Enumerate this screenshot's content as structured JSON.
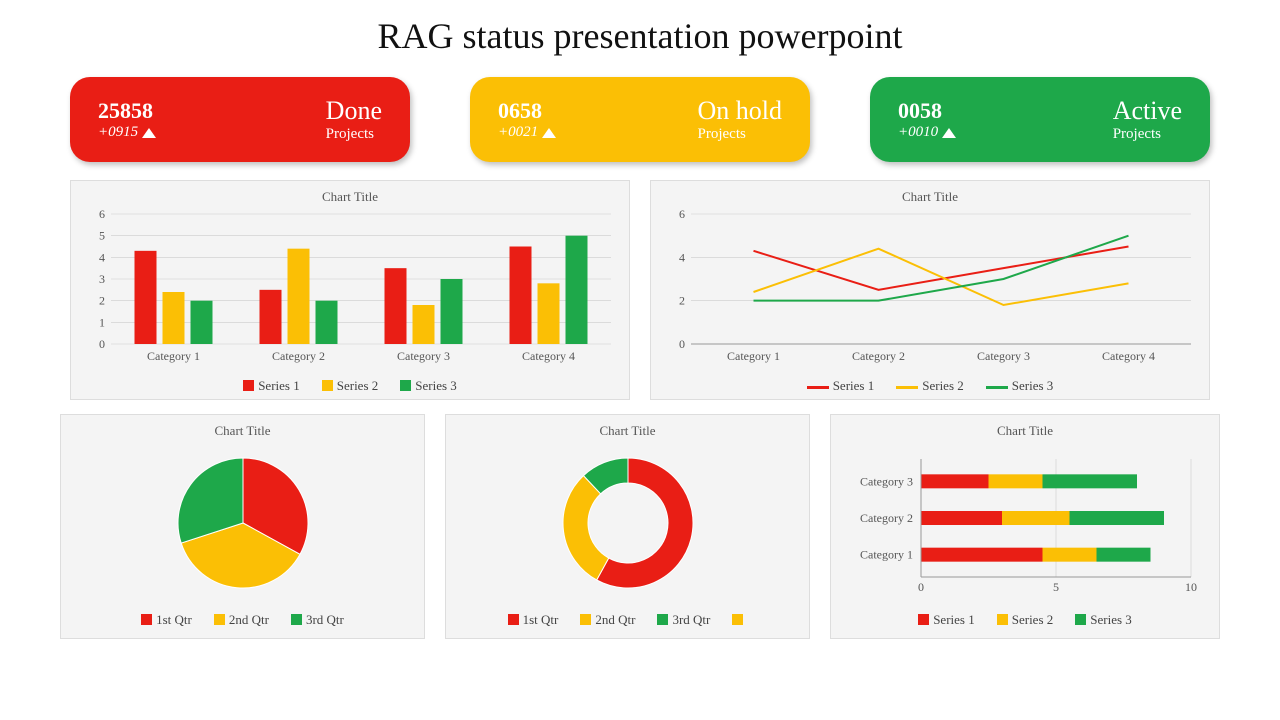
{
  "title": "RAG status presentation powerpoint",
  "cards": [
    {
      "value": "25858",
      "delta": "+0915",
      "status": "Done",
      "sub": "Projects"
    },
    {
      "value": "0658",
      "delta": "+0021",
      "status": "On hold",
      "sub": "Projects"
    },
    {
      "value": "0058",
      "delta": "+0010",
      "status": "Active",
      "sub": "Projects"
    }
  ],
  "chartTitleCommon": "Chart Title",
  "barLegend": [
    "Series 1",
    "Series 2",
    "Series 3"
  ],
  "lineLegend": [
    "Series 1",
    "Series 2",
    "Series 3"
  ],
  "pieLegend": [
    "1st Qtr",
    "2nd Qtr",
    "3rd Qtr"
  ],
  "donutLegend": [
    "1st Qtr",
    "2nd Qtr",
    "3rd Qtr",
    ""
  ],
  "hbarLegend": [
    "Series 1",
    "Series 2",
    "Series 3"
  ],
  "hbarCats": [
    "Category 3",
    "Category 2",
    "Category 1"
  ],
  "barCats": [
    "Category 1",
    "Category 2",
    "Category 3",
    "Category 4"
  ],
  "chart_data": [
    {
      "type": "bar",
      "title": "Chart Title",
      "categories": [
        "Category 1",
        "Category 2",
        "Category 3",
        "Category 4"
      ],
      "series": [
        {
          "name": "Series 1",
          "values": [
            4.3,
            2.5,
            3.5,
            4.5
          ],
          "color": "#e91e15"
        },
        {
          "name": "Series 2",
          "values": [
            2.4,
            4.4,
            1.8,
            2.8
          ],
          "color": "#fbbf05"
        },
        {
          "name": "Series 3",
          "values": [
            2.0,
            2.0,
            3.0,
            5.0
          ],
          "color": "#1ea84a"
        }
      ],
      "ylim": [
        0,
        6
      ],
      "yticks": [
        0,
        1,
        2,
        3,
        4,
        5,
        6
      ]
    },
    {
      "type": "line",
      "title": "Chart Title",
      "categories": [
        "Category 1",
        "Category 2",
        "Category 3",
        "Category 4"
      ],
      "series": [
        {
          "name": "Series 1",
          "values": [
            4.3,
            2.5,
            3.5,
            4.5
          ],
          "color": "#e91e15"
        },
        {
          "name": "Series 2",
          "values": [
            2.4,
            4.4,
            1.8,
            2.8
          ],
          "color": "#fbbf05"
        },
        {
          "name": "Series 3",
          "values": [
            2.0,
            2.0,
            3.0,
            5.0
          ],
          "color": "#1ea84a"
        }
      ],
      "ylim": [
        0,
        6
      ],
      "yticks": [
        0,
        2,
        4,
        6
      ]
    },
    {
      "type": "pie",
      "title": "Chart Title",
      "series": [
        {
          "name": "1st Qtr",
          "value": 33,
          "color": "#e91e15"
        },
        {
          "name": "2nd Qtr",
          "value": 37,
          "color": "#fbbf05"
        },
        {
          "name": "3rd Qtr",
          "value": 30,
          "color": "#1ea84a"
        }
      ]
    },
    {
      "type": "pie",
      "title": "Chart Title",
      "donut": true,
      "series": [
        {
          "name": "1st Qtr",
          "value": 58,
          "color": "#e91e15"
        },
        {
          "name": "2nd Qtr",
          "value": 30,
          "color": "#fbbf05"
        },
        {
          "name": "3rd Qtr",
          "value": 12,
          "color": "#1ea84a"
        }
      ]
    },
    {
      "type": "bar",
      "orientation": "horizontal-stacked",
      "title": "Chart Title",
      "categories": [
        "Category 3",
        "Category 2",
        "Category 1"
      ],
      "series": [
        {
          "name": "Series 1",
          "values": [
            2.5,
            3.0,
            4.5
          ],
          "color": "#e91e15"
        },
        {
          "name": "Series 2",
          "values": [
            2.0,
            2.5,
            2.0
          ],
          "color": "#fbbf05"
        },
        {
          "name": "Series 3",
          "values": [
            3.5,
            3.5,
            2.0
          ],
          "color": "#1ea84a"
        }
      ],
      "xlim": [
        0,
        10
      ],
      "xticks": [
        0,
        5,
        10
      ]
    }
  ]
}
